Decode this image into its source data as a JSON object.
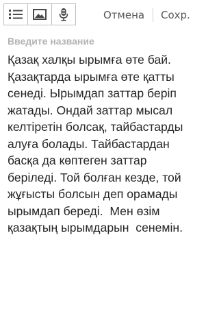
{
  "toolbar": {
    "buttons": [
      {
        "name": "list-button",
        "icon": "list-icon"
      },
      {
        "name": "image-button",
        "icon": "image-icon"
      },
      {
        "name": "voice-button",
        "icon": "microphone-icon"
      }
    ],
    "cancel_label": "Отмена",
    "save_label": "Сохр."
  },
  "note": {
    "title_placeholder": "Введите название",
    "title_value": "",
    "body_lines": [
      "Қазақ халқы ырымға өте бай.",
      "Қазақтарда ырымға өте қатты",
      "сенеді. Ырымдап заттар беріп",
      "жатады. Ондай заттар мысал",
      "келтіретін болсақ, тайбастарды",
      "алуға болады. Тайбастардан",
      "басқа да көптеген заттар",
      "беріледі. Той болған кезде, той",
      "жұғысты болсын деп орамады",
      "ырымдап береді.  Мен өзім",
      "қазақтың ырымдарын  сенемін."
    ]
  },
  "colors": {
    "background": "#ffffff",
    "text": "#262626",
    "placeholder": "#b3b3b3",
    "action_text": "#555555",
    "toolbar_border": "#bdbdbd"
  }
}
